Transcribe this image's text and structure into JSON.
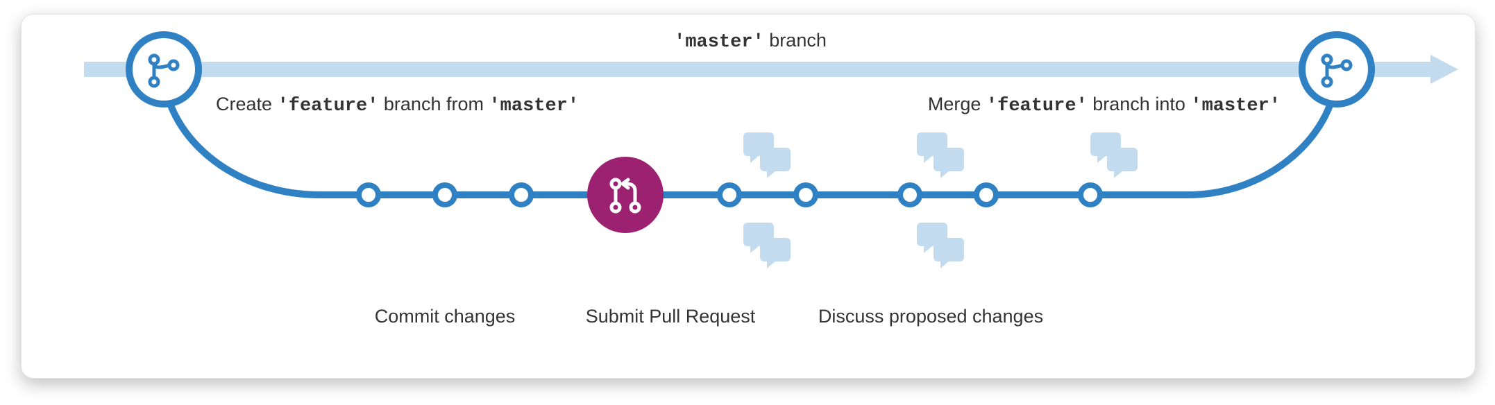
{
  "top": {
    "master_code": "'master'",
    "master_word": "branch"
  },
  "create": {
    "prefix": "Create",
    "feature_code": "'feature'",
    "mid": "branch from",
    "master_code": "'master'"
  },
  "merge": {
    "prefix": "Merge",
    "feature_code": "'feature'",
    "mid": "branch into",
    "master_code": "'master'"
  },
  "bottom": {
    "commit": "Commit changes",
    "submit": "Submit Pull Request",
    "discuss": "Discuss proposed changes"
  },
  "colors": {
    "blue": "#2f81c4",
    "light_blue": "#c3dbef",
    "purple": "#9c2271",
    "chat": "#c3dbef"
  }
}
